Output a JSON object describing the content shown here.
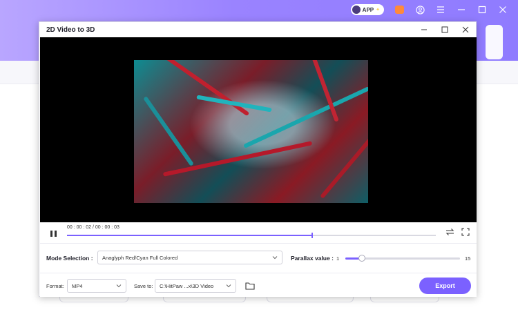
{
  "titlebar": {
    "app_badge": "APP"
  },
  "dialog": {
    "title": "2D Video to 3D"
  },
  "player": {
    "time": "00 : 00 : 02 / 00 : 00 : 03",
    "progress_fraction": 0.665
  },
  "settings": {
    "mode_label": "Mode Selection :",
    "mode_value": "Anaglyph Red/Cyan Full Colored",
    "parallax_label": "Parallax value :",
    "parallax_min": "1",
    "parallax_max": "15",
    "parallax_value": 3
  },
  "output": {
    "format_label": "Format:",
    "format_value": "MP4",
    "save_label": "Save to:",
    "save_value": "C:\\HitPaw ...x\\3D Video",
    "export_label": "Export"
  },
  "colors": {
    "accent": "#7b61ff",
    "header_gradient_start": "#b9a6ff",
    "header_gradient_end": "#8f7bff"
  }
}
